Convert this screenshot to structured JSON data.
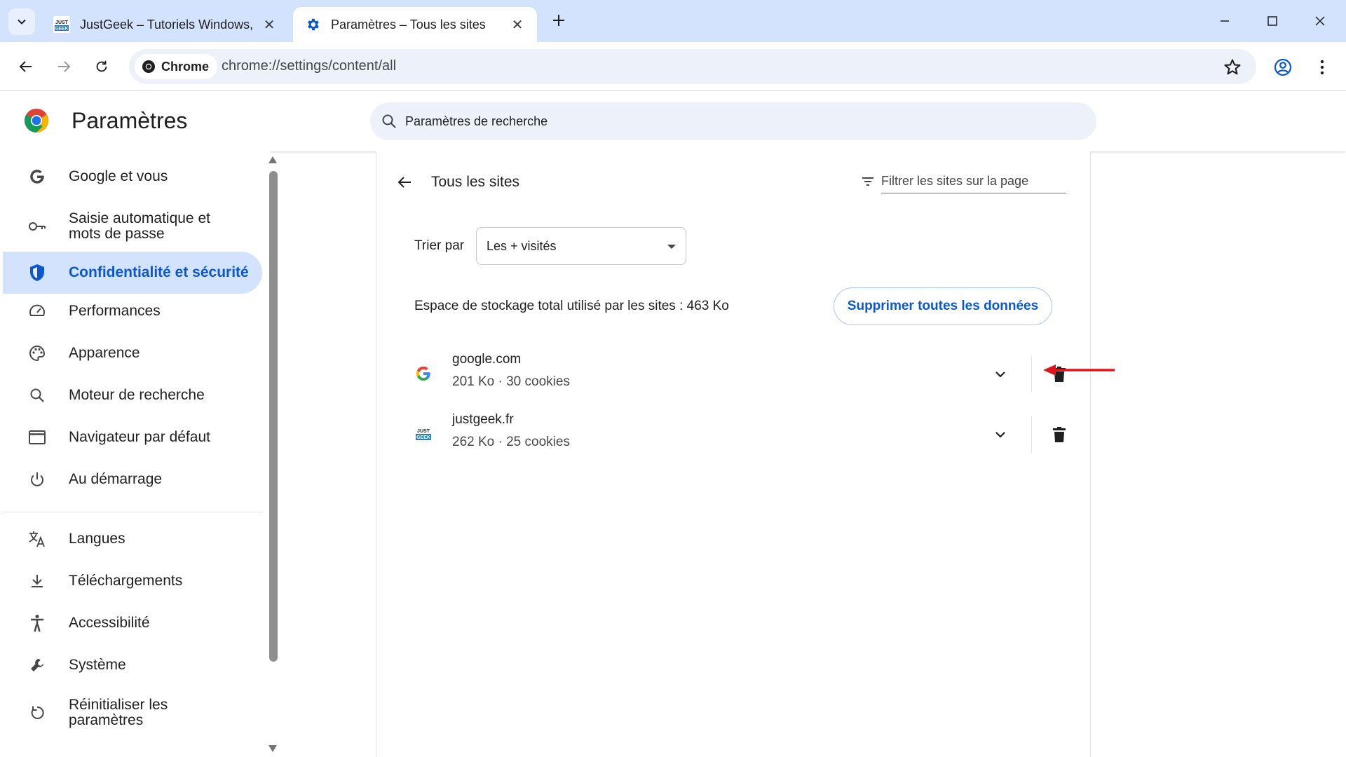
{
  "browser": {
    "tabs": [
      {
        "title": "JustGeek – Tutoriels Windows, L",
        "favicon_text": "JUST GEEK",
        "active": false
      },
      {
        "title": "Paramètres – Tous les sites",
        "active": true
      }
    ],
    "address": {
      "chip_label": "Chrome",
      "url": "chrome://settings/content/all"
    }
  },
  "settings": {
    "title": "Paramètres",
    "search_placeholder": "Paramètres de recherche"
  },
  "sidebar": {
    "items": [
      {
        "label": "Google et vous",
        "icon": "google-g-icon"
      },
      {
        "label": "Saisie automatique et mots de passe",
        "icon": "key-icon"
      },
      {
        "label": "Confidentialité et sécurité",
        "icon": "shield-icon",
        "selected": true
      },
      {
        "label": "Performances",
        "icon": "speedometer-icon"
      },
      {
        "label": "Apparence",
        "icon": "palette-icon"
      },
      {
        "label": "Moteur de recherche",
        "icon": "search-icon"
      },
      {
        "label": "Navigateur par défaut",
        "icon": "browser-window-icon"
      },
      {
        "label": "Au démarrage",
        "icon": "power-icon"
      },
      {
        "label": "Langues",
        "icon": "translate-icon"
      },
      {
        "label": "Téléchargements",
        "icon": "download-icon"
      },
      {
        "label": "Accessibilité",
        "icon": "accessibility-icon"
      },
      {
        "label": "Système",
        "icon": "wrench-icon"
      },
      {
        "label": "Réinitialiser les paramètres",
        "icon": "reset-icon"
      }
    ]
  },
  "main": {
    "heading": "Tous les sites",
    "filter_placeholder": "Filtrer les sites sur la page",
    "sort_label": "Trier par",
    "sort_value": "Les + visités",
    "storage_text": "Espace de stockage total utilisé par les sites : 463 Ko",
    "delete_all_label": "Supprimer toutes les données",
    "sites": [
      {
        "domain": "google.com",
        "meta": "201 Ko · 30 cookies",
        "favicon": "google-g-icon"
      },
      {
        "domain": "justgeek.fr",
        "meta": "262 Ko · 25 cookies",
        "favicon": "justgeek-icon",
        "favicon_text": "JUST GEEK"
      }
    ]
  },
  "colors": {
    "accent": "#0b57d0",
    "selected_bg": "#d3e3fd",
    "tabbar_bg": "#d3e3fd",
    "annotation_arrow": "#e0141a"
  }
}
